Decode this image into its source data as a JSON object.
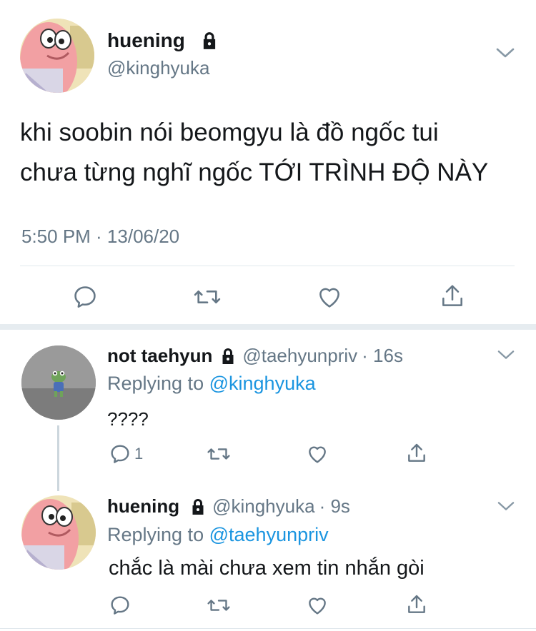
{
  "main_tweet": {
    "author_name": "huening",
    "author_handle": "@kinghyuka",
    "text_line1": "khi soobin nói beomgyu là đồ ngốc tui",
    "text_line2": "chưa từng nghĩ ngốc TỚI TRÌNH ĐỘ NÀY",
    "timestamp": "5:50 PM · 13/06/20"
  },
  "replies": [
    {
      "author_name": "not taehyun",
      "author_handle": "@taehyunpriv",
      "time": "· 16s",
      "replying_label": "Replying to",
      "replying_to": "@kinghyuka",
      "text": "????",
      "reply_count": "1"
    },
    {
      "author_name": "huening",
      "author_handle": "@kinghyuka",
      "time": "· 9s",
      "replying_label": "Replying to",
      "replying_to": "@taehyunpriv",
      "text": "chắc là mài chưa xem tin nhắn gòi"
    }
  ],
  "icons": {
    "reply": "reply-icon",
    "retweet": "retweet-icon",
    "like": "heart-icon",
    "share": "share-icon",
    "lock": "lock-icon",
    "more": "chevron-down-icon"
  },
  "colors": {
    "link": "#1b95e0",
    "muted": "#657786",
    "icon": "#657786"
  }
}
